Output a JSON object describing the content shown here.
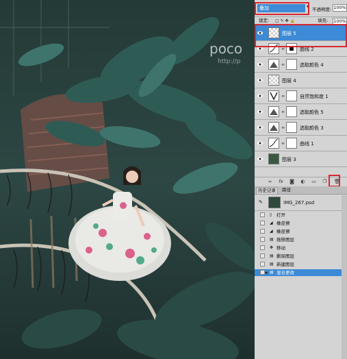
{
  "photo": {
    "watermark": "poco",
    "watermark_sub": "http://p"
  },
  "layers_panel": {
    "blend_mode": "叠加",
    "opacity_label": "不透明度:",
    "opacity_value": "100%",
    "lock_label": "锁定:",
    "fill_label": "填充:",
    "fill_value": "100%",
    "layers": [
      {
        "name": "图层 5",
        "type": "pixel",
        "selected": true
      },
      {
        "name": "曲线 2",
        "type": "curves",
        "selected": false
      },
      {
        "name": "选取颜色 4",
        "type": "selective-color",
        "selected": false
      },
      {
        "name": "图层 4",
        "type": "pixel",
        "selected": false
      },
      {
        "name": "自然饱和度 1",
        "type": "vibrance",
        "selected": false
      },
      {
        "name": "选取颜色 5",
        "type": "selective-color",
        "selected": false
      },
      {
        "name": "选取颜色 3",
        "type": "selective-color",
        "selected": false
      },
      {
        "name": "曲线 1",
        "type": "curves",
        "selected": false
      },
      {
        "name": "图层 3",
        "type": "photo",
        "selected": false
      }
    ]
  },
  "history_panel": {
    "tabs": [
      "历史记录",
      "路径"
    ],
    "snapshot_name": "IMG_267.psd",
    "items": [
      {
        "name": "打开",
        "selected": false
      },
      {
        "name": "橡皮擦",
        "selected": false
      },
      {
        "name": "橡皮擦",
        "selected": false
      },
      {
        "name": "拖移图层",
        "selected": false
      },
      {
        "name": "移动",
        "selected": false
      },
      {
        "name": "删除图层",
        "selected": false
      },
      {
        "name": "新建图层",
        "selected": false
      },
      {
        "name": "混合更改",
        "selected": true
      }
    ]
  },
  "colors": {
    "selection": "#3d8ad6",
    "highlight_box": "#d8262e",
    "panel_bg": "#d4d4d4"
  }
}
